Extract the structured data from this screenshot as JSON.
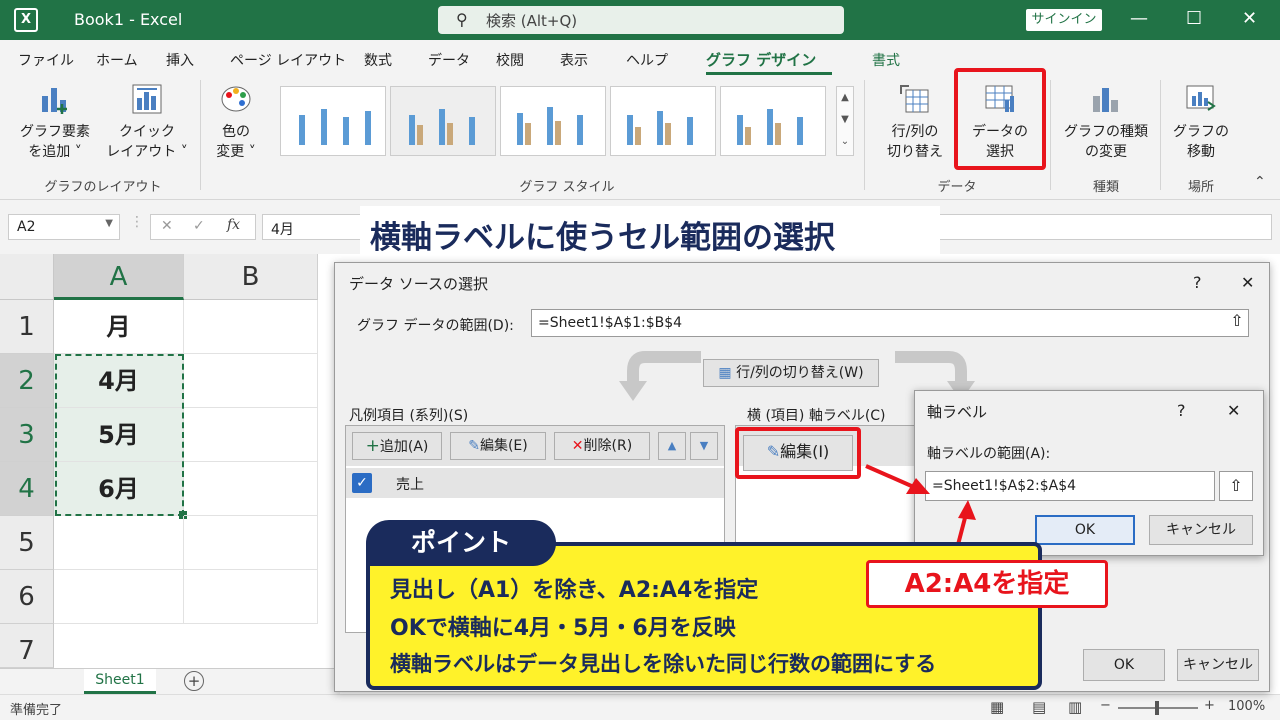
{
  "titlebar": {
    "app_icon": "X",
    "title": "Book1  -  Excel",
    "search_placeholder": "検索 (Alt+Q)",
    "signin": "サインイン"
  },
  "tabs": [
    "ファイル",
    "ホーム",
    "挿入",
    "ページ レイアウト",
    "数式",
    "データ",
    "校閲",
    "表示",
    "ヘルプ",
    "グラフ デザイン",
    "書式"
  ],
  "ribbon": {
    "add_element_1": "グラフ要素",
    "add_element_2": "を追加 ˅",
    "quick_layout_1": "クイック",
    "quick_layout_2": "レイアウト ˅",
    "colors_1": "色の",
    "colors_2": "変更 ˅",
    "group_layout": "グラフのレイアウト",
    "group_style": "グラフ スタイル",
    "switch_1": "行/列の",
    "switch_2": "切り替え",
    "select_data_1": "データの",
    "select_data_2": "選択",
    "group_data": "データ",
    "change_type_1": "グラフの種類",
    "change_type_2": "の変更",
    "group_type": "種類",
    "move_1": "グラフの",
    "move_2": "移動",
    "group_location": "場所"
  },
  "formula": {
    "name_box": "A2",
    "fx": "fx",
    "value": "4月"
  },
  "grid": {
    "columns": [
      "A",
      "B"
    ],
    "rows": [
      "1",
      "2",
      "3",
      "4",
      "5",
      "6",
      "7"
    ],
    "cells": [
      "月",
      "4月",
      "5月",
      "6月"
    ]
  },
  "sheet": {
    "tab": "Sheet1",
    "add": "+"
  },
  "status": {
    "ready": "準備完了",
    "zoom": "100%"
  },
  "banner": "横軸ラベルに使うセル範囲の選択",
  "dialog": {
    "title": "データ ソースの選択",
    "help": "?",
    "close": "✕",
    "range_label": "グラフ データの範囲(D):",
    "range_value": "=Sheet1!$A$1:$B$4",
    "switch_btn": "行/列の切り替え(W)",
    "legend_label": "凡例項目 (系列)(S)",
    "add_btn": "追加(A)",
    "edit_btn": "編集(E)",
    "delete_btn": "削除(R)",
    "series_item": "売上",
    "axis_label": "横 (項目) 軸ラベル(C)",
    "axis_edit_btn": "編集(I)",
    "ok": "OK",
    "cancel": "キャンセル"
  },
  "axis_dialog": {
    "title": "軸ラベル",
    "help": "?",
    "close": "✕",
    "range_label": "軸ラベルの範囲(A):",
    "range_value": "=Sheet1!$A$2:$A$4",
    "ok": "OK",
    "cancel": "キャンセル"
  },
  "point": {
    "tag": "ポイント",
    "line1": "見出し（A1）を除き、A2:A4を指定",
    "line2": "OKで横軸に4月・5月・6月を反映",
    "line3": "横軸ラベルはデータ見出しを除いた同じ行数の範囲にする"
  },
  "callout": "A2:A4を指定",
  "colors": {
    "excel_green": "#217346",
    "highlight_red": "#e8141c",
    "navy": "#1a2b5c",
    "yellow": "#fff22a"
  }
}
